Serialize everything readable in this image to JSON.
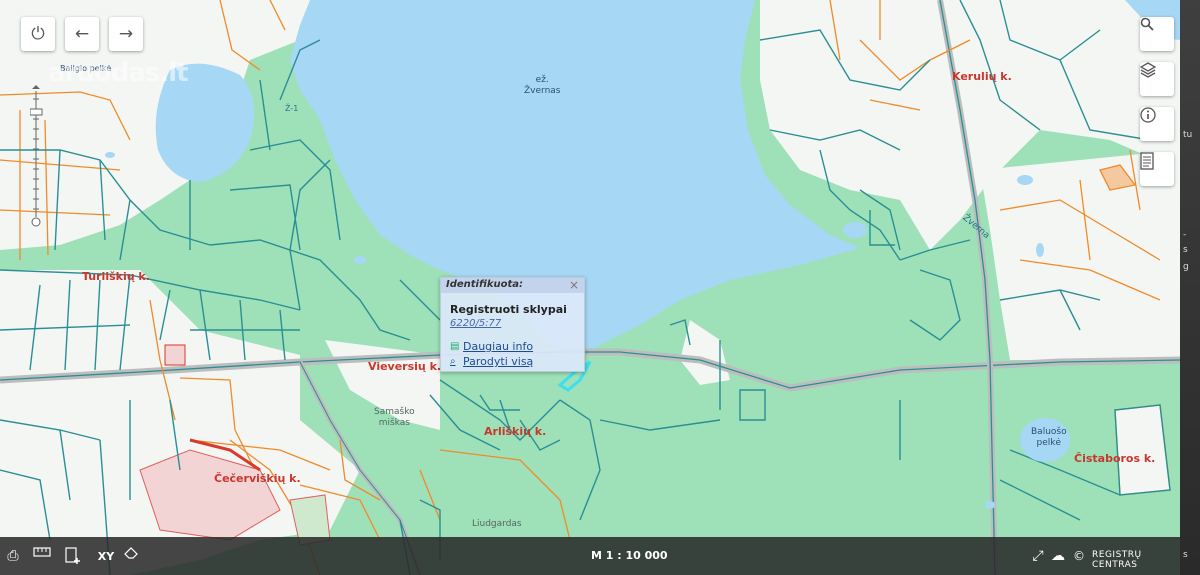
{
  "map": {
    "watermark": "aruodas.lt",
    "labels": {
      "lake_prefix": "ež.",
      "lake_name": "Žvernas",
      "bog_top": "Bailgio pelkė",
      "villages": [
        "Kerulių k.",
        "Turliškių k.",
        "Vieversių k.",
        "Arliškių k.",
        "Čečerviškių k.",
        "Čistaboros k."
      ],
      "forest_1a": "Samaško",
      "forest_1b": "miškas",
      "bog_2a": "Baluošo",
      "bog_2b": "pelkė",
      "road": "Žverna",
      "road_small": "Ž-1",
      "liudgardas": "Liudgardas"
    }
  },
  "controls": {
    "power": "power-icon",
    "back": "arrow-left-icon",
    "forward": "arrow-right-icon",
    "search": "search-icon",
    "layers": "layers-icon",
    "info": "info-icon",
    "legend": "document-icon"
  },
  "popup": {
    "header": "Identifikuota:",
    "close": "×",
    "title": "Registruoti sklypai",
    "parcel_id": "6220/5:77",
    "link_more": "Daugiau info",
    "link_show": "Parodyti visą"
  },
  "bottom_bar": {
    "scale": "M 1 : 10 000",
    "xy": "XY",
    "registry": "REGISTRŲ CENTRAS"
  },
  "right_strip": [
    "tu",
    "-",
    "s",
    "g",
    "s"
  ],
  "colors": {
    "water": "#a6d7f5",
    "forest": "#9ee0b8",
    "open_land": "#f3f6f3",
    "parcel_boundary": "#2a8f94",
    "cadastral_line": "#f08a2a",
    "village_label": "#c8372d"
  }
}
